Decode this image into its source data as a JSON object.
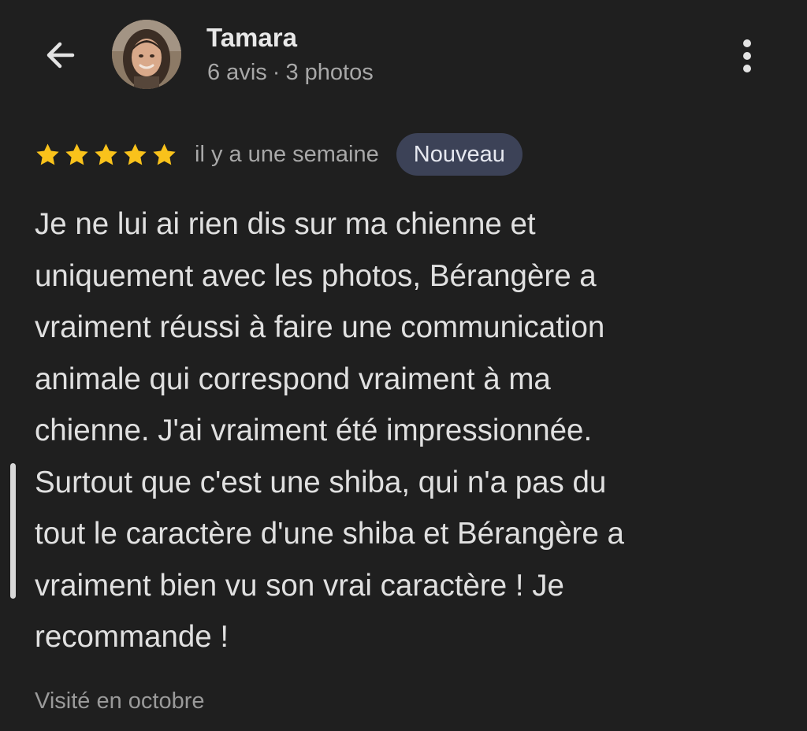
{
  "header": {
    "back_icon": "arrow-left-icon",
    "user_name": "Tamara",
    "reviews_count": "6 avis",
    "separator": "·",
    "photos_count": "3 photos",
    "more_icon": "more-vertical-icon"
  },
  "review": {
    "rating": 5,
    "rating_max": 5,
    "star_color": "#f9c21b",
    "time_ago": "il y a une semaine",
    "badge": "Nouveau",
    "lines": [
      "Je ne lui ai rien dis sur ma chienne et",
      "uniquement avec les photos, Bérangère a",
      "vraiment réussi à faire une communication",
      "animale qui correspond vraiment à ma",
      "chienne. J'ai vraiment été impressionnée.",
      "Surtout que c'est une shiba, qui n'a pas du",
      "tout le caractère d'une shiba et Bérangère a",
      "vraiment bien vu son vrai caractère ! Je",
      "recommande !"
    ],
    "visited": "Visité en octobre"
  },
  "colors": {
    "background": "#1f1f1f",
    "badge_background": "#3c4257",
    "secondary_text": "#a8a8a8"
  }
}
